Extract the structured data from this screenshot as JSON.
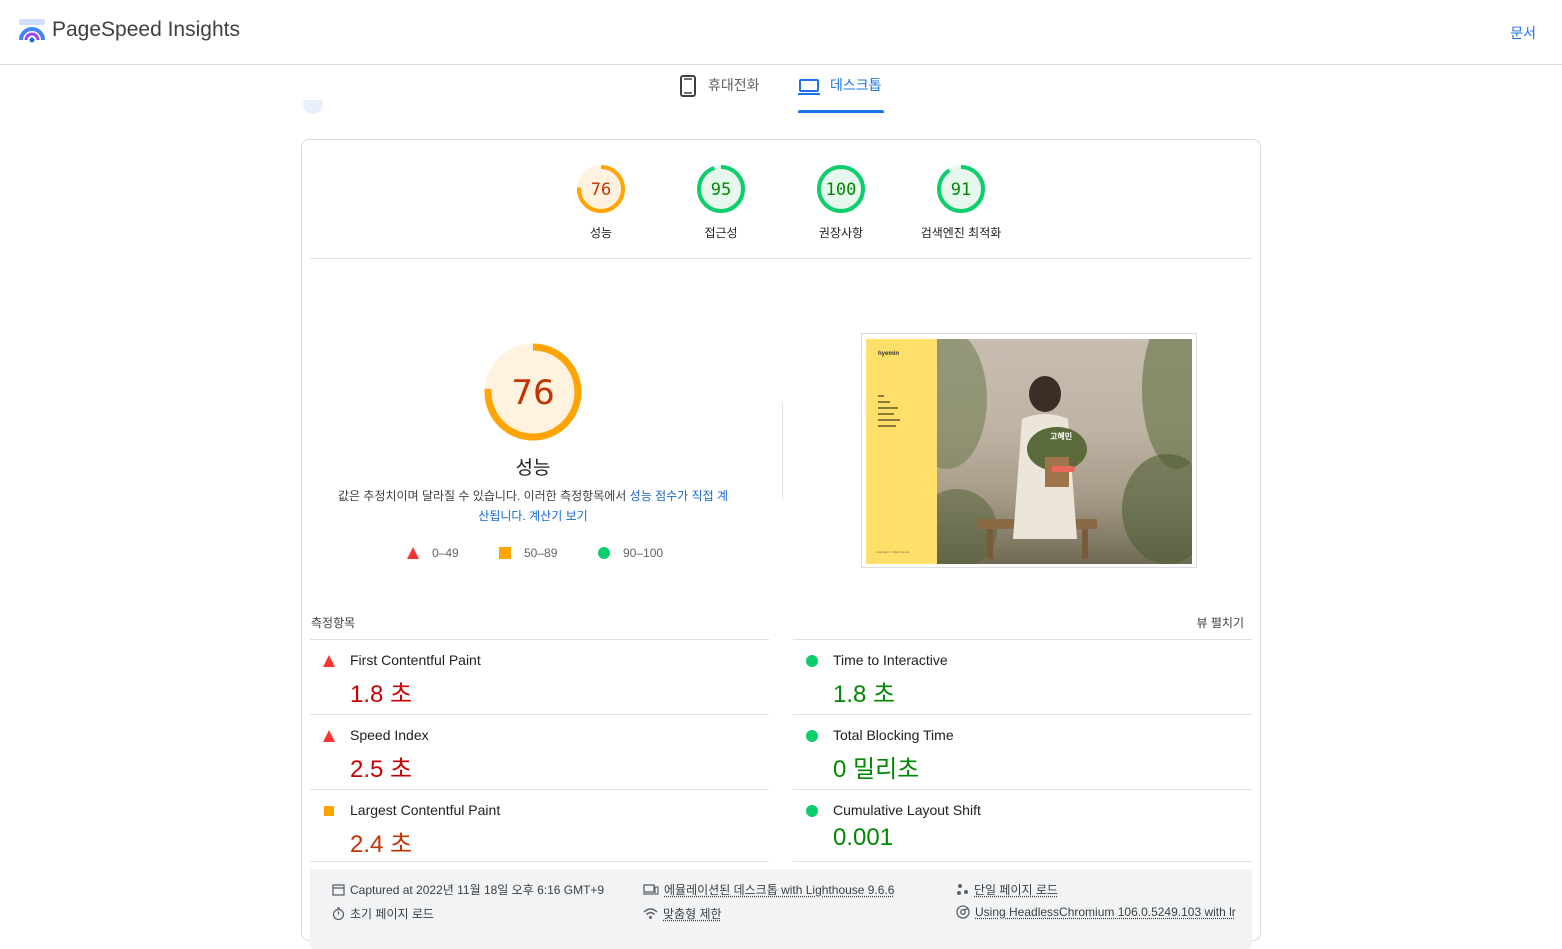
{
  "header": {
    "brand": "PageSpeed Insights",
    "docs_link": "문서"
  },
  "tabs": [
    {
      "label": "휴대전화",
      "icon": "phone-icon",
      "active": false
    },
    {
      "label": "데스크톱",
      "icon": "laptop-icon",
      "active": true
    }
  ],
  "colors": {
    "accent": "#1a73e8",
    "fail": "#cc0000",
    "average": "#c33300",
    "average_ring": "#ffa400",
    "pass": "#008800",
    "pass_ring": "#0cce6b",
    "fail_icon": "#ff3333"
  },
  "categories": [
    {
      "score": "76",
      "label": "성능",
      "status": "average",
      "value": 76
    },
    {
      "score": "95",
      "label": "접근성",
      "status": "pass",
      "value": 95
    },
    {
      "score": "100",
      "label": "권장사항",
      "status": "pass",
      "value": 100
    },
    {
      "score": "91",
      "label": "검색엔진 최적화",
      "status": "pass",
      "value": 91
    }
  ],
  "performance": {
    "score": "76",
    "value": 76,
    "title": "성능",
    "desc_text": "값은 추정치이며 달라질 수 있습니다. 이러한 측정항목에서 ",
    "desc_link1": "성능 점수가 직접 계산됩니다",
    "desc_sep": ". ",
    "desc_link2": "계산기 보기",
    "legend": [
      {
        "icon": "red-triangle-icon",
        "range": "0–49"
      },
      {
        "icon": "orange-square-icon",
        "range": "50–89"
      },
      {
        "icon": "green-circle-icon",
        "range": "90–100"
      }
    ]
  },
  "screenshot": {
    "site_name": "hyemin",
    "hero_name": "고혜민",
    "copyright": "Copyright © 2022 hyemin"
  },
  "metrics": {
    "title": "측정항목",
    "expand": "뷰 펼치기",
    "left": [
      {
        "name": "First Contentful Paint",
        "value": "1.8 초",
        "status": "fail"
      },
      {
        "name": "Speed Index",
        "value": "2.5 초",
        "status": "fail"
      },
      {
        "name": "Largest Contentful Paint",
        "value": "2.4 초",
        "status": "average"
      }
    ],
    "right": [
      {
        "name": "Time to Interactive",
        "value": "1.8 초",
        "status": "pass"
      },
      {
        "name": "Total Blocking Time",
        "value": "0 밀리초",
        "status": "pass"
      },
      {
        "name": "Cumulative Layout Shift",
        "value": "0.001",
        "status": "pass"
      }
    ]
  },
  "footer": {
    "captured": "Captured at 2022년 11월 18일 오후 6:16 GMT+9",
    "emulated": "에뮬레이션된 데스크톱 with Lighthouse 9.6.6",
    "single_load": "단일 페이지 로드",
    "initial_load": "초기 페이지 로드",
    "throttling": "맞춤형 제한",
    "browser": "Using HeadlessChromium 106.0.5249.103 with lr"
  }
}
